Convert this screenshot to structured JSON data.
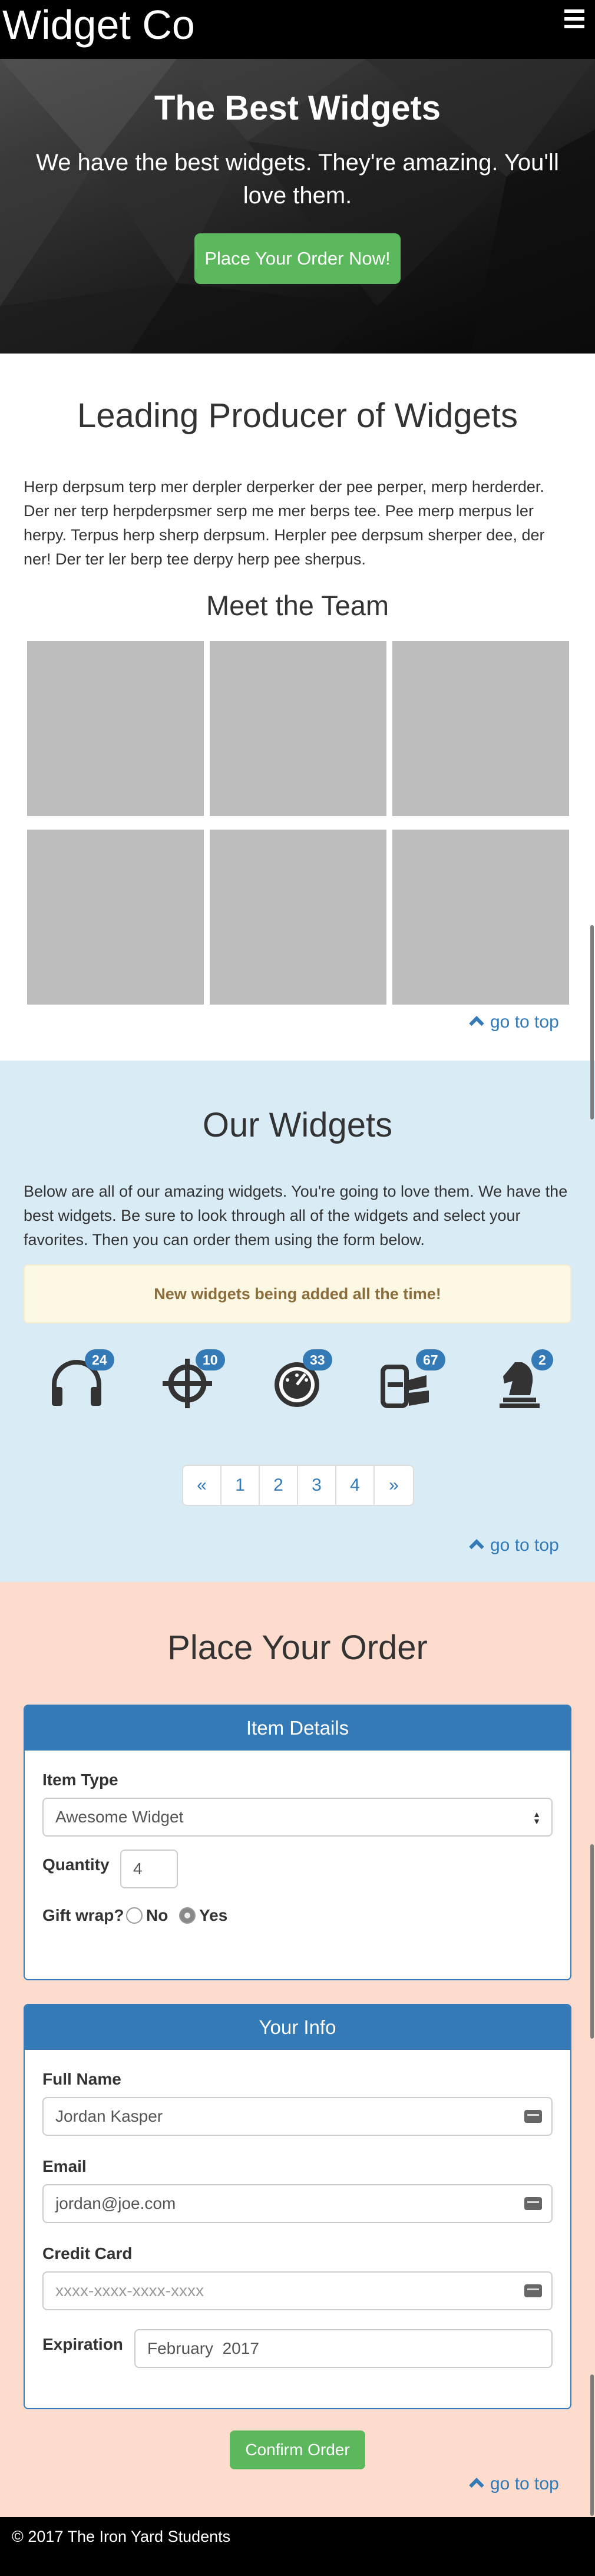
{
  "header": {
    "brand": "Widget Co",
    "menu_icon": "hamburger-menu-icon"
  },
  "hero": {
    "title": "The Best Widgets",
    "subtitle": "We have the best widgets. They're amazing. You'll love them.",
    "cta_label": "Place Your Order Now!"
  },
  "leading": {
    "title": "Leading Producer of Widgets",
    "text": "Herp derpsum terp mer derpler derperker der pee perper, merp herderder. Der ner terp herpderpsmer serp me mer berps tee. Pee merp merpus ler herpy. Terpus herp sherp derpsum. Herpler pee derpsum sherper dee, der ner! Der ter ler berp tee derpy herp pee sherpus.",
    "team_title": "Meet the Team",
    "go_to_top": "go to top"
  },
  "widgets": {
    "title": "Our Widgets",
    "text": "Below are all of our amazing widgets. You're going to love them. We have the best widgets. Be sure to look through all of the widgets and select your favorites. Then you can order them using the form below.",
    "alert": "New widgets being added all the time!",
    "items": [
      {
        "icon": "headphones-icon",
        "count": "24"
      },
      {
        "icon": "crosshairs-icon",
        "count": "10"
      },
      {
        "icon": "dashboard-icon",
        "count": "33"
      },
      {
        "icon": "hydrant-icon",
        "count": "67"
      },
      {
        "icon": "chess-knight-icon",
        "count": "2"
      }
    ],
    "pagination": [
      "«",
      "1",
      "2",
      "3",
      "4",
      "»"
    ],
    "go_to_top": "go to top"
  },
  "order": {
    "title": "Place Your Order",
    "item_details": {
      "header": "Item Details",
      "item_type_label": "Item Type",
      "item_type_value": "Awesome Widget",
      "quantity_label": "Quantity",
      "quantity_value": "4",
      "gift_wrap_label": "Gift wrap?",
      "gift_wrap_no": "No",
      "gift_wrap_yes": "Yes",
      "gift_wrap_selected": "Yes"
    },
    "your_info": {
      "header": "Your Info",
      "full_name_label": "Full Name",
      "full_name_value": "Jordan Kasper",
      "email_label": "Email",
      "email_value": "jordan@joe.com",
      "credit_card_label": "Credit Card",
      "credit_card_placeholder": "xxxx-xxxx-xxxx-xxxx",
      "expiration_label": "Expiration",
      "expiration_value": "February  2017"
    },
    "confirm_label": "Confirm Order",
    "go_to_top": "go to top"
  },
  "footer": {
    "text": "© 2017 The Iron Yard Students"
  },
  "colors": {
    "primary": "#337ab7",
    "success": "#5cb85c",
    "widgets_bg": "#d9ecf6",
    "order_bg": "#fddbcd",
    "alert_bg": "#fcf8e3"
  }
}
